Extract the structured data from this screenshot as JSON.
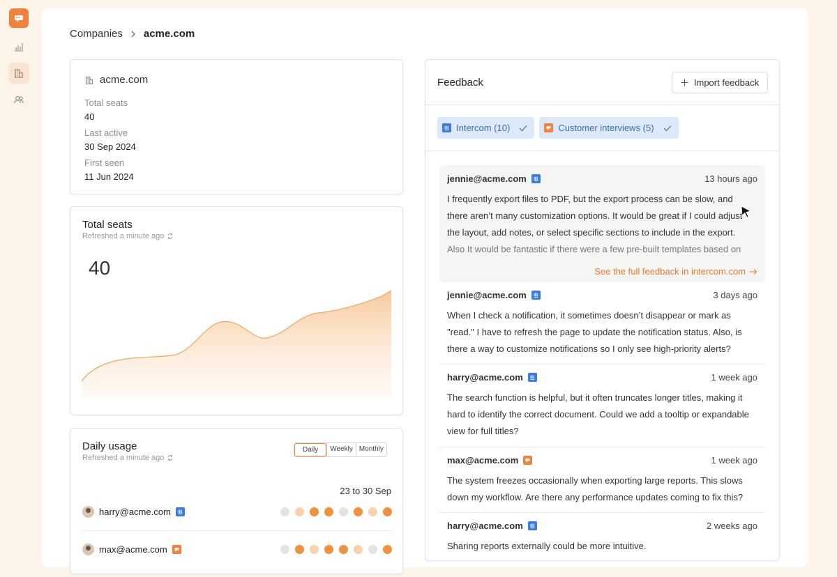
{
  "colors": {
    "accent": "#f2813b",
    "intercom": "#3b7ce0",
    "background": "#fdf5ea"
  },
  "sidebar": {
    "items": [
      {
        "icon": "chart-icon",
        "active": false
      },
      {
        "icon": "building-icon",
        "active": true
      },
      {
        "icon": "users-icon",
        "active": false
      }
    ]
  },
  "breadcrumb": {
    "parent": "Companies",
    "current": "acme.com"
  },
  "company": {
    "name": "acme.com",
    "fields": [
      {
        "label": "Total seats",
        "value": "40"
      },
      {
        "label": "Last active",
        "value": "30 Sep 2024"
      },
      {
        "label": "First seen",
        "value": "11 Jun 2024"
      }
    ]
  },
  "total_seats": {
    "title": "Total seats",
    "refreshed": "Refreshed a minute ago",
    "value": "40"
  },
  "daily_usage": {
    "title": "Daily usage",
    "refreshed": "Refreshed a minute ago",
    "tabs": [
      "Daily",
      "Weekly",
      "Monthly"
    ],
    "active_tab": "Daily",
    "range": "23 to 30 Sep",
    "rows": [
      {
        "user": "harry@acme.com",
        "source": "intercom",
        "levels": [
          "none",
          "low",
          "high",
          "high",
          "none",
          "high",
          "low",
          "high"
        ]
      },
      {
        "user": "max@acme.com",
        "source": "interview",
        "levels": [
          "none",
          "high",
          "low",
          "high",
          "high",
          "low",
          "none",
          "high"
        ]
      }
    ]
  },
  "feedback": {
    "title": "Feedback",
    "import_label": "Import feedback",
    "filters": [
      {
        "label": "Intercom (10)",
        "source": "intercom"
      },
      {
        "label": "Customer interviews (5)",
        "source": "interview"
      }
    ],
    "items": [
      {
        "user": "jennie@acme.com",
        "source": "intercom",
        "time": "13 hours ago",
        "lines": [
          "I frequently export files to PDF, but the export process can be slow, and",
          "there aren’t many customization options. It would be great if I could adjust",
          "the layout, add notes, or select specific sections to include in the export.",
          "Also It would be fantastic if there were a few pre-built templates based on"
        ],
        "link": "See the full feedback in intercom.com"
      },
      {
        "user": "jennie@acme.com",
        "source": "intercom",
        "time": "3 days ago",
        "lines": [
          "When I check a notification, it sometimes doesn’t disappear or mark as",
          "\"read.\" I have to refresh the page to update the notification status. Also, is",
          "there a way to customize notifications so I only see high-priority alerts?"
        ]
      },
      {
        "user": "harry@acme.com",
        "source": "intercom",
        "time": "1 week ago",
        "lines": [
          "The search function is helpful, but it often truncates longer titles, making it",
          "hard to identify the correct document. Could we add a tooltip or expandable",
          "view for full titles?"
        ]
      },
      {
        "user": "max@acme.com",
        "source": "interview",
        "time": "1 week ago",
        "lines": [
          "The system freezes occasionally when exporting large reports. This slows",
          "down my workflow. Are there any performance updates coming to fix this?"
        ]
      },
      {
        "user": "harry@acme.com",
        "source": "intercom",
        "time": "2 weeks ago",
        "lines": [
          "Sharing reports externally could be more intuitive."
        ]
      }
    ]
  }
}
